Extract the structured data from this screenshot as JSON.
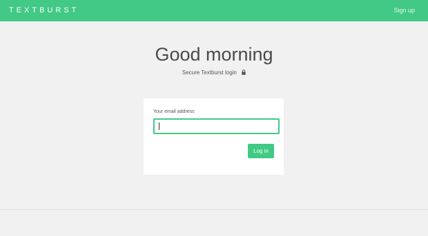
{
  "header": {
    "brand": "TEXTBURST",
    "signup_label": "Sign up"
  },
  "main": {
    "greeting": "Good morning",
    "subtitle": "Secure Textburst login",
    "subtitle_icon": "lock-icon"
  },
  "login_form": {
    "email_label": "Your email address",
    "email_value": "",
    "email_placeholder": "",
    "submit_label": "Log in"
  },
  "colors": {
    "accent": "#41c985",
    "background": "#f1f1f1",
    "card": "#ffffff"
  }
}
